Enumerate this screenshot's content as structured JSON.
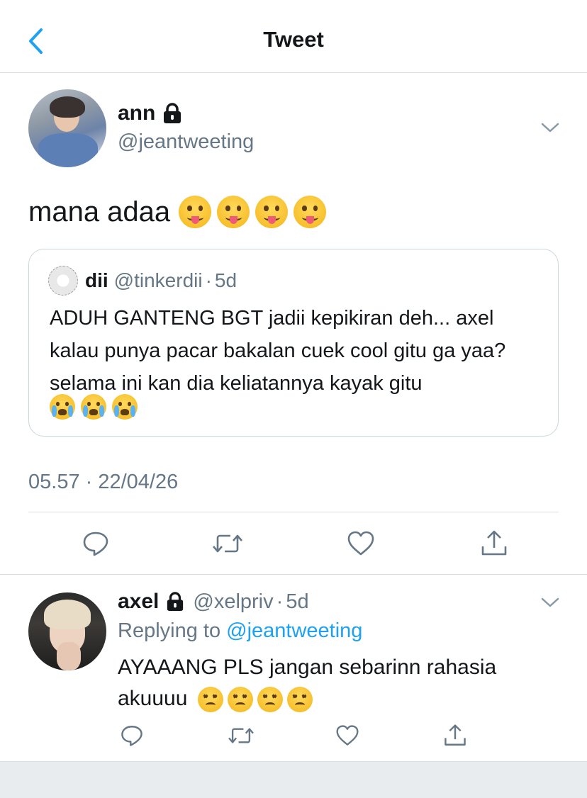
{
  "header": {
    "title": "Tweet",
    "back_icon": "chevron-left-icon"
  },
  "main_tweet": {
    "author": {
      "name": "ann",
      "handle": "@jeantweeting",
      "protected": true
    },
    "text": "mana adaa",
    "emojis": [
      "stuck-out-tongue-face",
      "stuck-out-tongue-face",
      "stuck-out-tongue-face",
      "stuck-out-tongue-face"
    ],
    "quoted": {
      "name": "dii",
      "handle": "@tinkerdii",
      "separator": "·",
      "time": "5d",
      "text": "ADUH GANTENG BGT jadii kepikiran deh... axel kalau punya pacar bakalan cuek cool gitu ga yaa? selama ini kan dia keliatannya kayak gitu",
      "emojis": [
        "loudly-crying-face",
        "loudly-crying-face",
        "loudly-crying-face"
      ]
    },
    "timestamp": "05.57 · 22/04/26",
    "actions": [
      "reply-icon",
      "retweet-icon",
      "like-icon",
      "share-icon"
    ]
  },
  "reply": {
    "author": {
      "name": "axel",
      "handle": "@xelpriv",
      "protected": true
    },
    "separator": "·",
    "time": "5d",
    "replying_prefix": "Replying to",
    "replying_to": "@jeantweeting",
    "text": "AYAAANG PLS jangan sebarinn rahasia akuuuu",
    "emojis": [
      "persevering-face",
      "persevering-face",
      "persevering-face",
      "persevering-face"
    ],
    "actions": [
      "reply-icon",
      "retweet-icon",
      "like-icon",
      "share-icon"
    ]
  },
  "colors": {
    "accent": "#1da1f2",
    "text": "#14171a",
    "muted": "#657786",
    "border": "#ccd6dd"
  }
}
